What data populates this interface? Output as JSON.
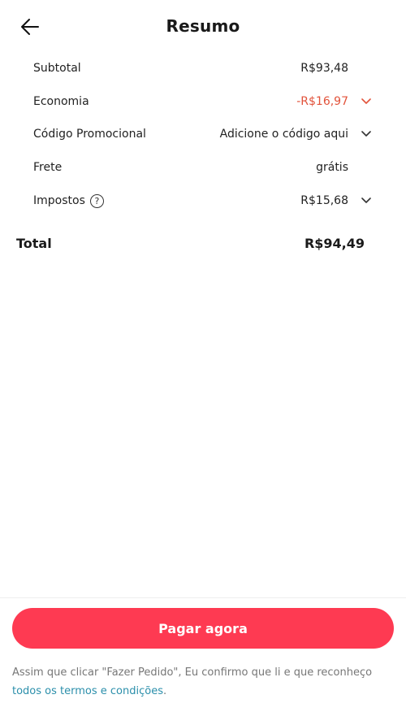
{
  "header": {
    "back_icon": "arrow-left-icon",
    "title": "Resumo"
  },
  "summary": {
    "subtotal": {
      "label": "Subtotal",
      "value": "R$93,48"
    },
    "savings": {
      "label": "Economia",
      "value": "-R$16,97",
      "color": "#e2533b"
    },
    "promo": {
      "label": "Código Promocional",
      "value": "Adicione o código aqui"
    },
    "shipping": {
      "label": "Frete",
      "value": "grátis"
    },
    "taxes": {
      "label": "Impostos",
      "help": "?",
      "value": "R$15,68"
    }
  },
  "total": {
    "label": "Total",
    "value": "R$94,49"
  },
  "footer": {
    "pay_label": "Pagar agora",
    "pay_color": "#fe3a52",
    "terms_text": "Assim que clicar \"Fazer Pedido\", Eu confirmo que li e que reconheço ",
    "terms_link": "todos os termos e condições",
    "terms_end": "."
  }
}
